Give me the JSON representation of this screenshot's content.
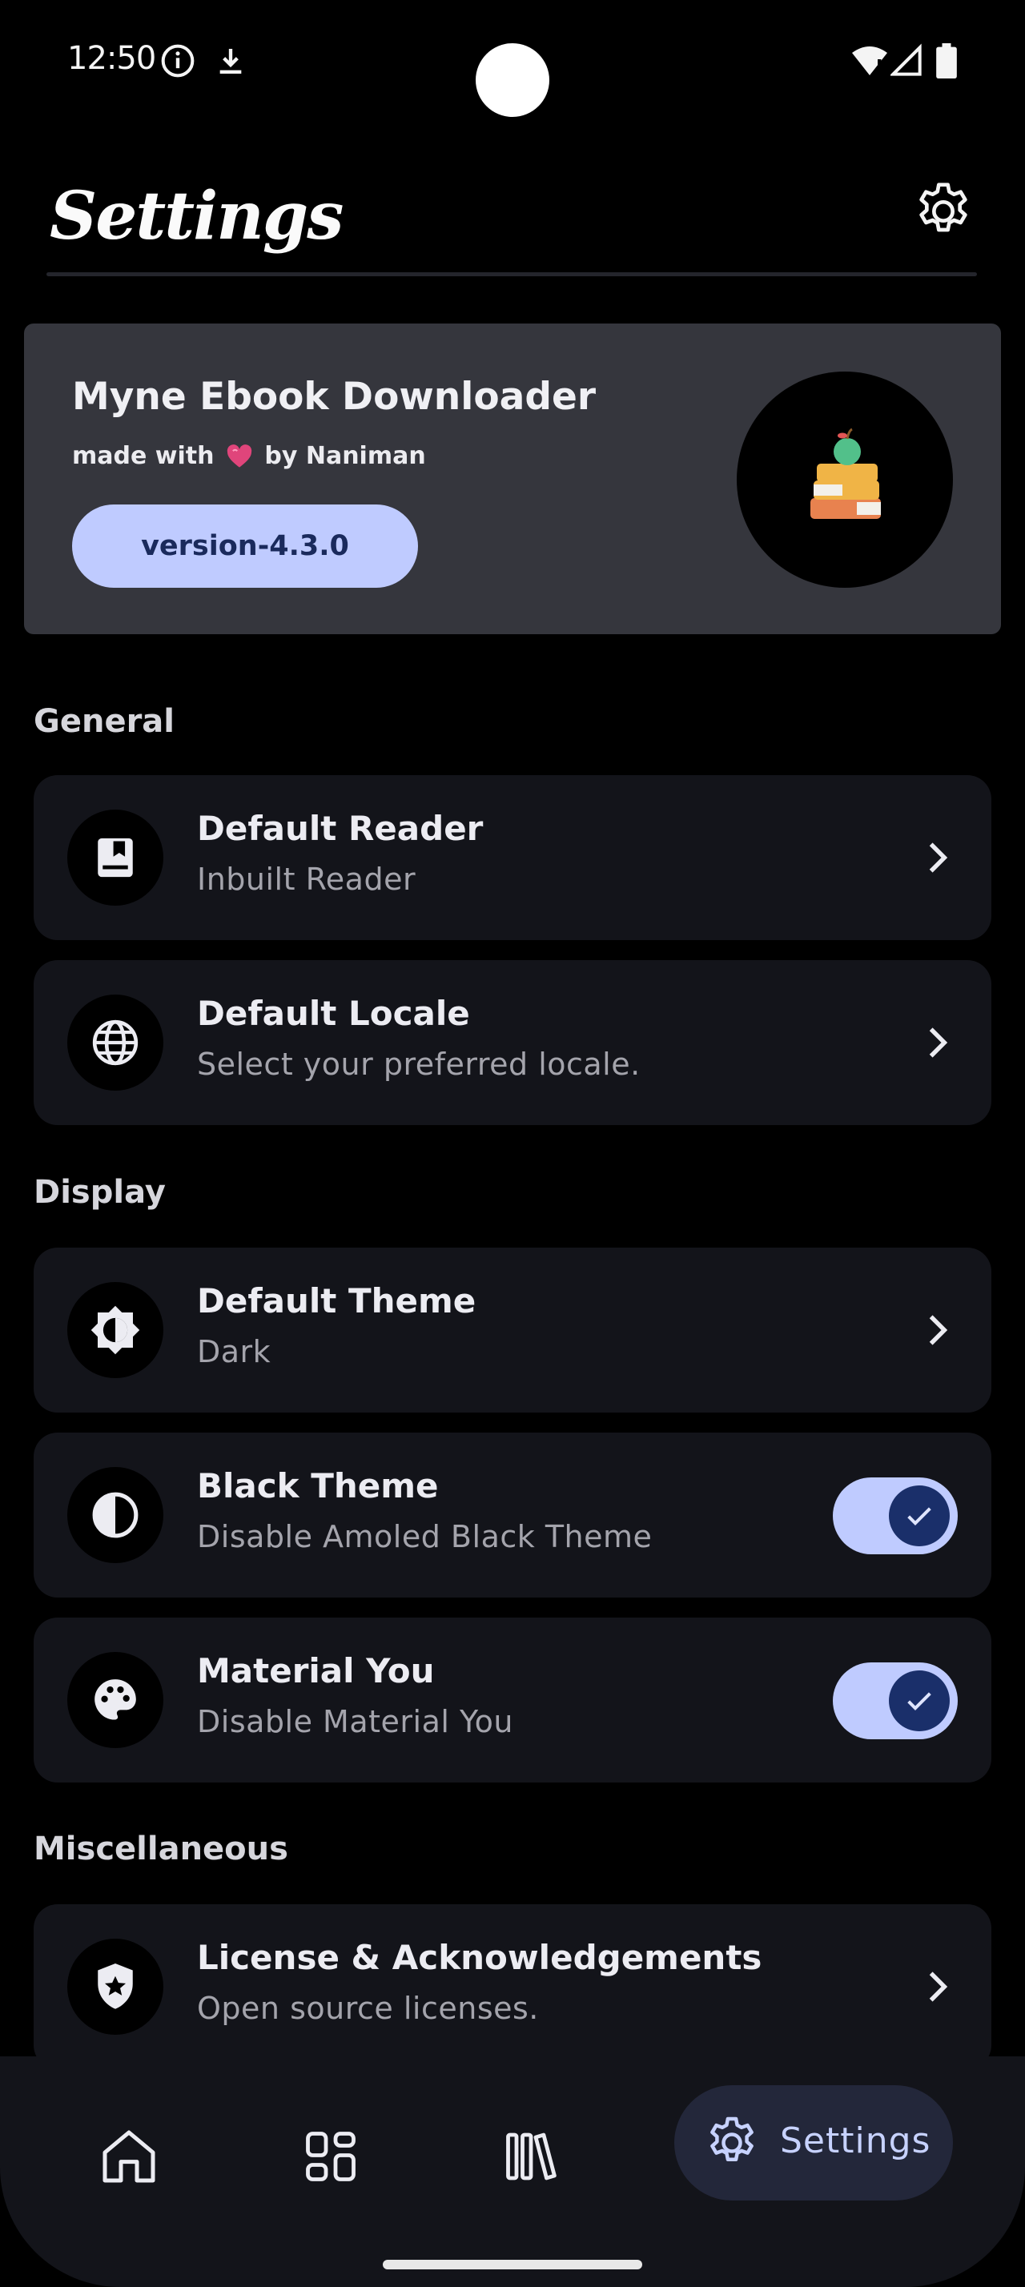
{
  "status_bar": {
    "time": "12:50",
    "icons": [
      "info-icon",
      "download-icon",
      "wifi-icon",
      "signal-icon",
      "battery-icon"
    ]
  },
  "header": {
    "title": "Settings",
    "icon": "gear-icon"
  },
  "app_card": {
    "name": "Myne Ebook Downloader",
    "made_prefix": "made with",
    "made_suffix": "by Naniman",
    "version": "version-4.3.0",
    "logo_icon": "books-apple-icon",
    "heart_icon": "heart-icon"
  },
  "sections": {
    "general": "General",
    "display": "Display",
    "misc": "Miscellaneous"
  },
  "items": {
    "default_reader": {
      "title": "Default Reader",
      "subtitle": "Inbuilt Reader",
      "icon": "book-icon"
    },
    "default_locale": {
      "title": "Default Locale",
      "subtitle": "Select your preferred locale.",
      "icon": "globe-icon"
    },
    "default_theme": {
      "title": "Default Theme",
      "subtitle": "Dark",
      "icon": "brightness-icon"
    },
    "black_theme": {
      "title": "Black Theme",
      "subtitle": "Disable Amoled Black Theme",
      "icon": "contrast-icon",
      "enabled": true
    },
    "material_you": {
      "title": "Material You",
      "subtitle": "Disable Material You",
      "icon": "palette-icon",
      "enabled": true
    },
    "license": {
      "title": "License & Acknowledgements",
      "subtitle": "Open source licenses.",
      "icon": "shield-star-icon"
    }
  },
  "bottom_nav": {
    "items": [
      {
        "icon": "home-icon"
      },
      {
        "icon": "categories-icon"
      },
      {
        "icon": "library-icon"
      },
      {
        "icon": "gear-icon",
        "label": "Settings",
        "active": true
      }
    ]
  },
  "colors": {
    "accent": "#bfcbff",
    "card": "#35363d",
    "row": "#13141a"
  }
}
